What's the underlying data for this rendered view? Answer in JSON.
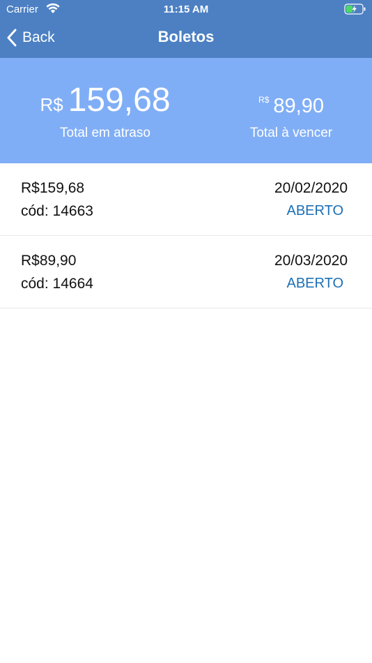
{
  "status_bar": {
    "carrier": "Carrier",
    "time": "11:15 AM",
    "wifi_icon": "wifi-icon",
    "battery_icon": "battery-charging-icon"
  },
  "nav": {
    "back_label": "Back",
    "title": "Boletos",
    "background_color": "#4c80c3"
  },
  "summary": {
    "background_color": "#80aef6",
    "overdue": {
      "currency": "R$",
      "amount": "159,68",
      "label": "Total em atraso"
    },
    "upcoming": {
      "currency": "R$",
      "amount": "89,90",
      "label": "Total à vencer"
    }
  },
  "boletos": [
    {
      "amount": "R$159,68",
      "code": "cód: 14663",
      "due_date": "20/02/2020",
      "status": "ABERTO"
    },
    {
      "amount": "R$89,90",
      "code": "cód: 14664",
      "due_date": "20/03/2020",
      "status": "ABERTO"
    }
  ],
  "colors": {
    "status_open": "#1b6fb5"
  }
}
